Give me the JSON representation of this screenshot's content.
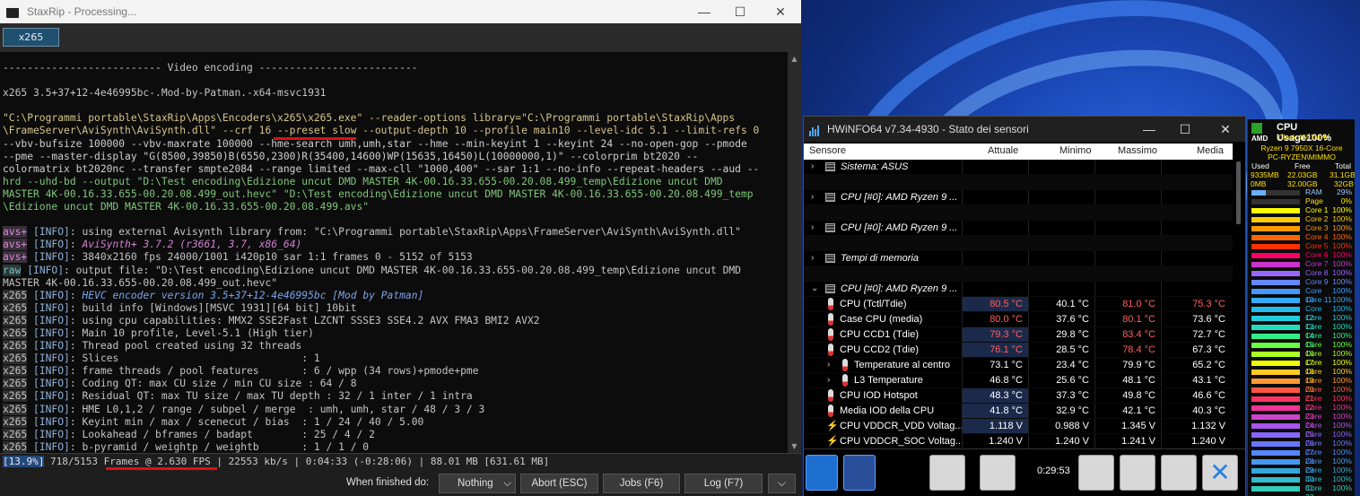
{
  "staxrip": {
    "title": "StaxRip - Processing...",
    "tab": "x265",
    "log": [
      {
        "t": "-------------------------- Video encoding --------------------------"
      },
      {
        "t": ""
      },
      {
        "t": "x265 3.5+37+12-4e46995bc-.Mod-by-Patman.-x64-msvc1931"
      },
      {
        "t": ""
      },
      {
        "t": "\"C:\\Programmi portable\\StaxRip\\Apps\\Encoders\\x265\\x265.exe\" --reader-options library=\"C:\\Programmi portable\\StaxRip\\Apps",
        "c": "c-cmd"
      },
      {
        "t": "\\FrameServer\\AviSynth\\AviSynth.dll\" --crf 16 --preset slow --output-depth 10 --profile main10 --level-idc 5.1 --limit-refs 0",
        "c": "c-cmd"
      },
      {
        "t": "--vbv-bufsize 100000 --vbv-maxrate 100000 --hme-search umh,umh,star --hme --min-keyint 1 --keyint 24 --no-open-gop --pmode",
        "c": "c-opt"
      },
      {
        "t": "--pme --master-display \"G(8500,39850)B(6550,2300)R(35400,14600)WP(15635,16450)L(10000000,1)\" --colorprim bt2020 --",
        "c": "c-opt"
      },
      {
        "t": "colormatrix bt2020nc --transfer smpte2084 --range limited --max-cll \"1000,400\" --sar 1:1 --no-info --repeat-headers --aud --",
        "c": "c-opt"
      },
      {
        "t": "hrd --uhd-bd --output \"D:\\Test encoding\\Edizione uncut DMD MASTER 4K-00.16.33.655-00.20.08.499_temp\\Edizione uncut DMD",
        "c": "c-grn"
      },
      {
        "t": "MASTER 4K-00.16.33.655-00.20.08.499_out.hevc\" \"D:\\Test encoding\\Edizione uncut DMD MASTER 4K-00.16.33.655-00.20.08.499_temp",
        "c": "c-grn"
      },
      {
        "t": "\\Edizione uncut DMD MASTER 4K-00.16.33.655-00.20.08.499.avs\"",
        "c": "c-grn"
      },
      {
        "t": ""
      },
      {
        "tag": "avs+",
        "tc": "tag-avs",
        "info": "[INFO]",
        "t": ": using external Avisynth library from: \"C:\\Programmi portable\\StaxRip\\Apps\\FrameServer\\AviSynth\\AviSynth.dll\""
      },
      {
        "tag": "avs+",
        "tc": "tag-avs",
        "info": "[INFO]",
        "t": ": ",
        "s": "AviSynth+ 3.7.2 (r3661, 3.7, x86_64)",
        "sc": "c-mag"
      },
      {
        "tag": "avs+",
        "tc": "tag-avs",
        "info": "[INFO]",
        "t": ": 3840x2160 fps 24000/1001 i420p10 sar 1:1 frames 0 - 5152 of 5153"
      },
      {
        "tag": "raw",
        "tc": "tag-raw",
        "info": "[INFO]",
        "t": ": output file: \"D:\\Test encoding\\Edizione uncut DMD MASTER 4K-00.16.33.655-00.20.08.499_temp\\Edizione uncut DMD"
      },
      {
        "t": "MASTER 4K-00.16.33.655-00.20.08.499_out.hevc\""
      },
      {
        "tag": "x265",
        "tc": "tag",
        "info": "[INFO]",
        "t": ": ",
        "s": "HEVC encoder version 3.5+37+12-4e46995bc [Mod by Patman]",
        "sc": "c-blu"
      },
      {
        "tag": "x265",
        "tc": "tag",
        "info": "[INFO]",
        "t": ": build info [Windows][MSVC 1931][64 bit] 10bit"
      },
      {
        "tag": "x265",
        "tc": "tag",
        "info": "[INFO]",
        "t": ": using cpu capabilities: MMX2 SSE2Fast LZCNT SSSE3 SSE4.2 AVX FMA3 BMI2 AVX2"
      },
      {
        "tag": "x265",
        "tc": "tag",
        "info": "[INFO]",
        "t": ": Main 10 profile, Level-5.1 (High tier)"
      },
      {
        "tag": "x265",
        "tc": "tag",
        "info": "[INFO]",
        "t": ": Thread pool created using 32 threads"
      },
      {
        "tag": "x265",
        "tc": "tag",
        "info": "[INFO]",
        "t": ": Slices                              : 1"
      },
      {
        "tag": "x265",
        "tc": "tag",
        "info": "[INFO]",
        "t": ": frame threads / pool features       : 6 / wpp (34 rows)+pmode+pme"
      },
      {
        "tag": "x265",
        "tc": "tag",
        "info": "[INFO]",
        "t": ": Coding QT: max CU size / min CU size : 64 / 8"
      },
      {
        "tag": "x265",
        "tc": "tag",
        "info": "[INFO]",
        "t": ": Residual QT: max TU size / max TU depth : 32 / 1 inter / 1 intra"
      },
      {
        "tag": "x265",
        "tc": "tag",
        "info": "[INFO]",
        "t": ": HME L0,1,2 / range / subpel / merge  : umh, umh, star / 48 / 3 / 3"
      },
      {
        "tag": "x265",
        "tc": "tag",
        "info": "[INFO]",
        "t": ": Keyint min / max / scenecut / bias  : 1 / 24 / 40 / 5.00"
      },
      {
        "tag": "x265",
        "tc": "tag",
        "info": "[INFO]",
        "t": ": Lookahead / bframes / badapt        : 25 / 4 / 2"
      },
      {
        "tag": "x265",
        "tc": "tag",
        "info": "[INFO]",
        "t": ": b-pyramid / weightp / weightb       : 1 / 1 / 0"
      }
    ],
    "status": {
      "progress": "[13.9%]",
      "frames": " 718/5153 Frames @ 2.630 FPS ",
      "rest": "| 22553 kb/s | 0:04:33 (-0:28:06) | 88.01 MB [631.61 MB]",
      "progress_value": 0.139
    },
    "when_finished_label": "When finished do:",
    "buttons": {
      "nothing": "Nothing",
      "abort": "Abort (ESC)",
      "jobs": "Jobs (F6)",
      "log": "Log (F7)"
    }
  },
  "hwinfo": {
    "title": "HWiNFO64 v7.34-4930 - Stato dei sensori",
    "headers": {
      "sensor": "Sensore",
      "current": "Attuale",
      "min": "Minimo",
      "max": "Massimo",
      "avg": "Media"
    },
    "rows": [
      {
        "type": "group",
        "name": "Sistema: ASUS",
        "exp": "›"
      },
      {
        "type": "blank"
      },
      {
        "type": "group",
        "name": "CPU [#0]: AMD Ryzen 9 ...",
        "exp": "›"
      },
      {
        "type": "blank"
      },
      {
        "type": "group",
        "name": "CPU [#0]: AMD Ryzen 9 ...",
        "exp": "›"
      },
      {
        "type": "blank"
      },
      {
        "type": "group",
        "name": "Tempi di memoria",
        "exp": "›"
      },
      {
        "type": "blank"
      },
      {
        "type": "group",
        "name": "CPU [#0]: AMD Ryzen 9 ...",
        "exp": "⌄"
      },
      {
        "type": "data",
        "icon": "therm",
        "name": "CPU (Tctl/Tdie)",
        "v": [
          "80.5 °C",
          "40.1 °C",
          "81.0 °C",
          "75.3 °C"
        ],
        "red": [
          true,
          false,
          true,
          true
        ],
        "hi": true
      },
      {
        "type": "data",
        "icon": "therm",
        "name": "Case CPU (media)",
        "v": [
          "80.0 °C",
          "37.6 °C",
          "80.1 °C",
          "73.6 °C"
        ],
        "red": [
          true,
          false,
          true,
          false
        ],
        "hi": false
      },
      {
        "type": "data",
        "icon": "therm",
        "name": "CPU CCD1 (Tdie)",
        "v": [
          "79.3 °C",
          "29.8 °C",
          "83.4 °C",
          "72.7 °C"
        ],
        "red": [
          true,
          false,
          true,
          false
        ],
        "hi": true
      },
      {
        "type": "data",
        "icon": "therm",
        "name": "CPU CCD2 (Tdie)",
        "v": [
          "76.1 °C",
          "28.5 °C",
          "78.4 °C",
          "67.3 °C"
        ],
        "red": [
          true,
          false,
          true,
          false
        ],
        "hi": true
      },
      {
        "type": "data",
        "icon": "therm",
        "sub": true,
        "name": "Temperature al centro",
        "v": [
          "73.1 °C",
          "23.4 °C",
          "79.9 °C",
          "65.2 °C"
        ],
        "red": [
          false,
          false,
          false,
          false
        ],
        "hi": false
      },
      {
        "type": "data",
        "icon": "therm",
        "sub": true,
        "name": "L3 Temperature",
        "v": [
          "46.8 °C",
          "25.6 °C",
          "48.1 °C",
          "43.1 °C"
        ],
        "red": [
          false,
          false,
          false,
          false
        ],
        "hi": false
      },
      {
        "type": "data",
        "icon": "therm",
        "name": "CPU IOD Hotspot",
        "v": [
          "48.3 °C",
          "37.3 °C",
          "49.8 °C",
          "46.6 °C"
        ],
        "red": [
          false,
          false,
          false,
          false
        ],
        "hi": true
      },
      {
        "type": "data",
        "icon": "therm",
        "name": "Media IOD della CPU",
        "v": [
          "41.8 °C",
          "32.9 °C",
          "42.1 °C",
          "40.3 °C"
        ],
        "red": [
          false,
          false,
          false,
          false
        ],
        "hi": true
      },
      {
        "type": "data",
        "icon": "bolt",
        "name": "CPU VDDCR_VDD Voltag...",
        "v": [
          "1.118 V",
          "0.988 V",
          "1.345 V",
          "1.132 V"
        ],
        "red": [
          false,
          false,
          false,
          false
        ],
        "hi": true
      },
      {
        "type": "data",
        "icon": "bolt",
        "name": "CPU VDDCR_SOC Voltag...",
        "v": [
          "1.240 V",
          "1.240 V",
          "1.241 V",
          "1.240 V"
        ],
        "red": [
          false,
          false,
          false,
          false
        ],
        "hi": false
      }
    ],
    "elapsed": "0:29:53"
  },
  "cpu_widget": {
    "title": "CPU Usage",
    "total": "100%",
    "clock": "Clock:4501MHz",
    "model": "Ryzen 9 7950X 16-Core",
    "pc": "PC-RYZEN\\MIMMO",
    "mem_headers": [
      "Used",
      "Free",
      "Total"
    ],
    "mem_row1": [
      "9335MB",
      "22.03GB",
      "31.1GB"
    ],
    "mem_row2": [
      "0MB",
      "32.00GB",
      "32GB"
    ],
    "ram": {
      "name": "RAM",
      "pct": "29%",
      "value": 0.29
    },
    "page": {
      "name": "Page",
      "pct": "0%",
      "value": 0.0
    },
    "cores": [
      {
        "name": "Core 1",
        "pct": "100%",
        "color": "#ffff00"
      },
      {
        "name": "Core 2",
        "pct": "100%",
        "color": "#ffcc00"
      },
      {
        "name": "Core 3",
        "pct": "100%",
        "color": "#ff9900"
      },
      {
        "name": "Core 4",
        "pct": "100%",
        "color": "#ff6600"
      },
      {
        "name": "Core 5",
        "pct": "100%",
        "color": "#ff3300"
      },
      {
        "name": "Core 6",
        "pct": "100%",
        "color": "#ff0066"
      },
      {
        "name": "Core 7",
        "pct": "100%",
        "color": "#cc33cc"
      },
      {
        "name": "Core 8",
        "pct": "100%",
        "color": "#9966ff"
      },
      {
        "name": "Core 9",
        "pct": "100%",
        "color": "#6688ff"
      },
      {
        "name": "Core 10",
        "pct": "100%",
        "color": "#4499ff"
      },
      {
        "name": "Core 11",
        "pct": "100%",
        "color": "#33aaff"
      },
      {
        "name": "Core 12",
        "pct": "100%",
        "color": "#22bbee"
      },
      {
        "name": "Core 13",
        "pct": "100%",
        "color": "#22ccdd"
      },
      {
        "name": "Core 14",
        "pct": "100%",
        "color": "#22ddbb"
      },
      {
        "name": "Core 15",
        "pct": "100%",
        "color": "#33ee88"
      },
      {
        "name": "Core 16",
        "pct": "100%",
        "color": "#66ff44"
      },
      {
        "name": "Core 17",
        "pct": "100%",
        "color": "#aaff22"
      },
      {
        "name": "Core 18",
        "pct": "100%",
        "color": "#eeff00"
      },
      {
        "name": "Core 19",
        "pct": "100%",
        "color": "#ffcc22"
      },
      {
        "name": "Core 20",
        "pct": "100%",
        "color": "#ff9933"
      },
      {
        "name": "Core 21",
        "pct": "100%",
        "color": "#ff5544"
      },
      {
        "name": "Core 22",
        "pct": "100%",
        "color": "#ff3366"
      },
      {
        "name": "Core 23",
        "pct": "100%",
        "color": "#ee3399"
      },
      {
        "name": "Core 24",
        "pct": "100%",
        "color": "#cc44cc"
      },
      {
        "name": "Core 25",
        "pct": "100%",
        "color": "#aa55ee"
      },
      {
        "name": "Core 26",
        "pct": "100%",
        "color": "#8866ff"
      },
      {
        "name": "Core 27",
        "pct": "100%",
        "color": "#6677ff"
      },
      {
        "name": "Core 28",
        "pct": "100%",
        "color": "#5588ff"
      },
      {
        "name": "Core 29",
        "pct": "100%",
        "color": "#4499ee"
      },
      {
        "name": "Core 30",
        "pct": "100%",
        "color": "#33aadd"
      },
      {
        "name": "Core 31",
        "pct": "100%",
        "color": "#33bbcc"
      },
      {
        "name": "Core 32",
        "pct": "100%",
        "color": "#33ccbb"
      }
    ]
  }
}
